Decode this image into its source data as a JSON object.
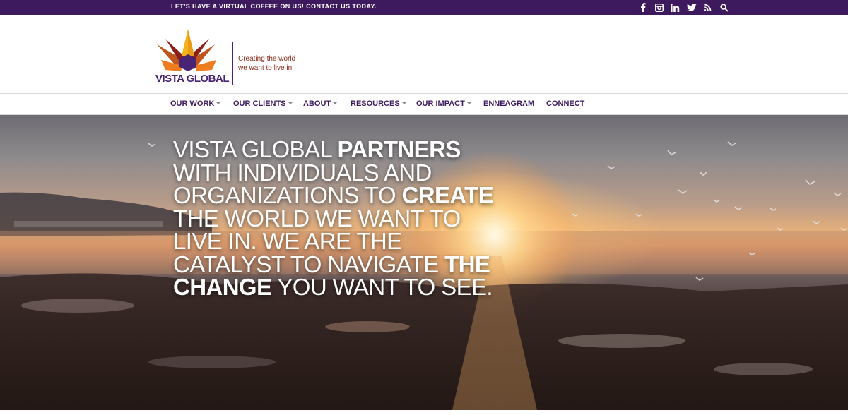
{
  "topbar": {
    "message": "LET'S HAVE A VIRTUAL COFFEE ON US! CONTACT US TODAY.",
    "social_icons": [
      "facebook-icon",
      "instagram-icon",
      "linkedin-icon",
      "twitter-icon",
      "rss-icon",
      "search-icon"
    ]
  },
  "header": {
    "logo_text": "VISTA GLOBAL",
    "tagline_line1": "Creating the world",
    "tagline_line2": "we want to live in"
  },
  "nav": {
    "items": [
      {
        "label": "OUR WORK",
        "dropdown": true
      },
      {
        "label": "OUR CLIENTS",
        "dropdown": true
      },
      {
        "label": "ABOUT",
        "dropdown": true
      },
      {
        "label": "RESOURCES",
        "dropdown": true
      },
      {
        "label": "OUR IMPACT",
        "dropdown": true
      },
      {
        "label": "ENNEAGRAM",
        "dropdown": false
      },
      {
        "label": "CONNECT",
        "dropdown": false
      }
    ]
  },
  "hero": {
    "segments": [
      {
        "text": "VISTA GLOBAL ",
        "bold": false
      },
      {
        "text": "PARTNERS",
        "bold": true
      },
      {
        "text": " WITH INDIVIDUALS AND ORGANIZATIONS TO ",
        "bold": false
      },
      {
        "text": "CREATE",
        "bold": true
      },
      {
        "text": " THE WORLD WE WANT TO LIVE IN. WE ARE THE CATALYST TO NAVIGATE ",
        "bold": false
      },
      {
        "text": "THE CHANGE",
        "bold": true
      },
      {
        "text": " YOU WANT TO SEE.",
        "bold": false
      }
    ]
  },
  "colors": {
    "brand_purple": "#3d1a5e",
    "logo_purple": "#4a2474",
    "tagline_brown": "#8a2a1a"
  }
}
